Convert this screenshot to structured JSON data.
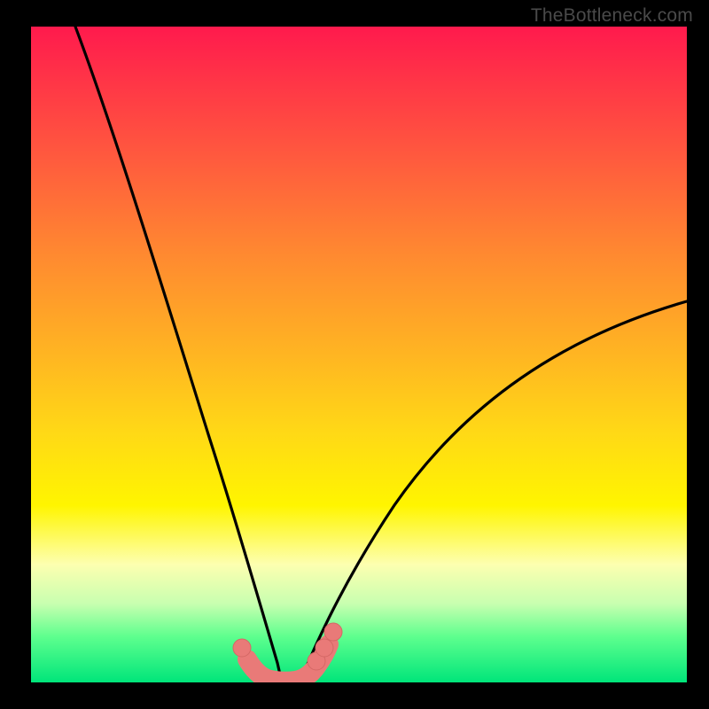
{
  "watermark": "TheBottleneck.com",
  "chart_data": {
    "type": "line",
    "title": "",
    "xlabel": "",
    "ylabel": "",
    "xlim": [
      0,
      100
    ],
    "ylim": [
      0,
      100
    ],
    "grid": false,
    "legend": false,
    "series": [
      {
        "name": "left-curve",
        "x": [
          7,
          10,
          14,
          18,
          22,
          26,
          29,
          31,
          33,
          34.5,
          36.5,
          38
        ],
        "y": [
          100,
          86,
          70,
          54,
          40,
          27,
          17,
          11,
          6,
          3,
          1,
          0
        ]
      },
      {
        "name": "right-curve",
        "x": [
          41,
          43,
          44.5,
          46,
          48,
          52,
          58,
          66,
          76,
          88,
          100
        ],
        "y": [
          0,
          1,
          3,
          5,
          9,
          16,
          25,
          34,
          43,
          51,
          58
        ]
      },
      {
        "name": "bottom-band",
        "x": [
          33,
          35,
          37,
          38.5,
          40,
          41.5,
          43,
          45
        ],
        "y": [
          3.5,
          1.2,
          0.2,
          0,
          0,
          0.4,
          2.0,
          4.8
        ]
      }
    ],
    "colors": {
      "curve": "#000000",
      "marker_fill": "#e97a78",
      "marker_stroke": "#c95754",
      "background_top": "#ff1a4d",
      "background_bottom": "#00e57a"
    }
  }
}
